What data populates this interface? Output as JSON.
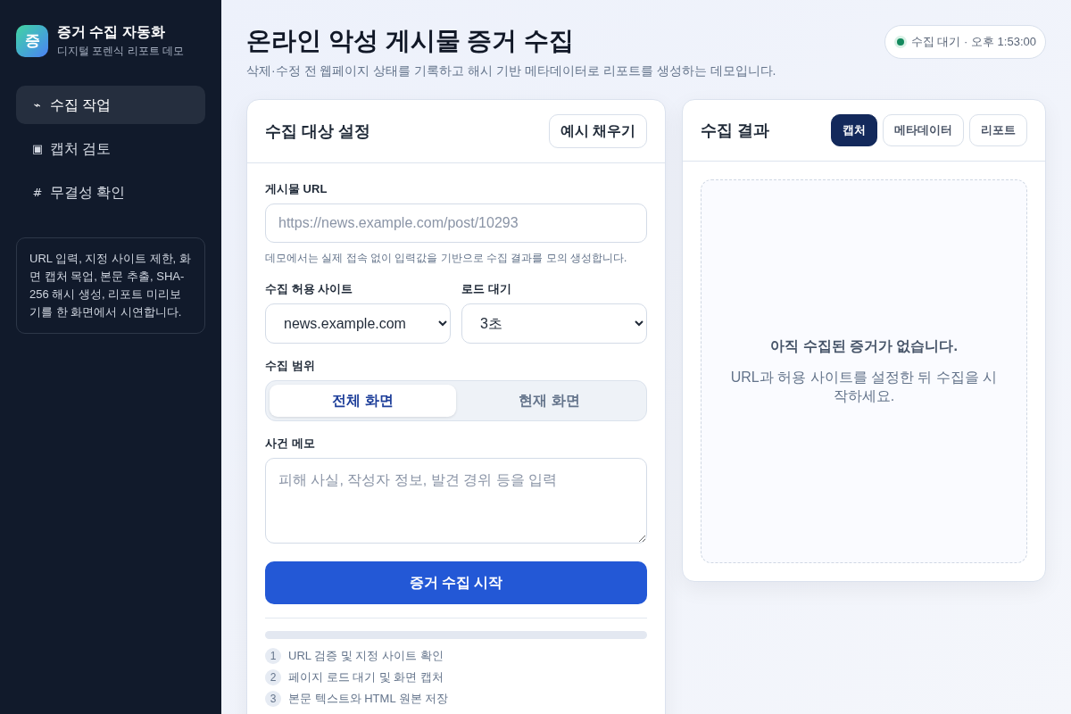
{
  "sidebar": {
    "logo_letter": "증",
    "app_title": "증거 수집 자동화",
    "app_subtitle": "디지털 포렌식 리포트 데모",
    "nav_items": [
      {
        "icon": "⌁",
        "label": "수집 작업",
        "selected": true
      },
      {
        "icon": "▣",
        "label": "캡처 검토",
        "selected": false
      },
      {
        "icon": "#",
        "label": "무결성 확인",
        "selected": false
      }
    ],
    "info_text": "URL 입력, 지정 사이트 제한, 화면 캡처 목업, 본문 추출, SHA-256 해시 생성, 리포트 미리보기를 한 화면에서 시연합니다."
  },
  "header": {
    "title": "온라인 악성 게시물 증거 수집",
    "subtitle": "삭제·수정 전 웹페이지 상태를 기록하고 해시 기반 메타데이터로 리포트를 생성하는 데모입니다.",
    "status": "수집 대기 · 오후 1:53:00"
  },
  "form_card": {
    "title": "수집 대상 설정",
    "fill_example_button": "예시 채우기",
    "url_field": {
      "label": "게시물 URL",
      "placeholder": "https://news.example.com/post/10293",
      "help": "데모에서는 실제 접속 없이 입력값을 기반으로 수집 결과를 모의 생성합니다."
    },
    "site_select": {
      "label": "수집 허용 사이트",
      "value": "news.example.com"
    },
    "wait_select": {
      "label": "로드 대기",
      "value": "3초"
    },
    "scope": {
      "label": "수집 범위",
      "options": [
        {
          "label": "전체 화면",
          "selected": true
        },
        {
          "label": "현재 화면",
          "selected": false
        }
      ]
    },
    "memo": {
      "label": "사건 메모",
      "placeholder": "피해 사실, 작성자 정보, 발견 경위 등을 입력"
    },
    "submit_button": "증거 수집 시작",
    "progress": {
      "level": 0
    },
    "steps": [
      {
        "number": "1",
        "text": "URL 검증 및 지정 사이트 확인"
      },
      {
        "number": "2",
        "text": "페이지 로드 대기 및 화면 캡처"
      },
      {
        "number": "3",
        "text": "본문 텍스트와 HTML 원본 저장"
      }
    ]
  },
  "result_card": {
    "title": "수집 결과",
    "tabs": [
      {
        "label": "캡처",
        "selected": true
      },
      {
        "label": "메타데이터",
        "selected": false
      },
      {
        "label": "리포트",
        "selected": false
      }
    ],
    "empty_state": {
      "title": "아직 수집된 증거가 없습니다.",
      "message": "URL과 허용 사이트를 설정한 뒤 수집을 시작하세요."
    }
  }
}
